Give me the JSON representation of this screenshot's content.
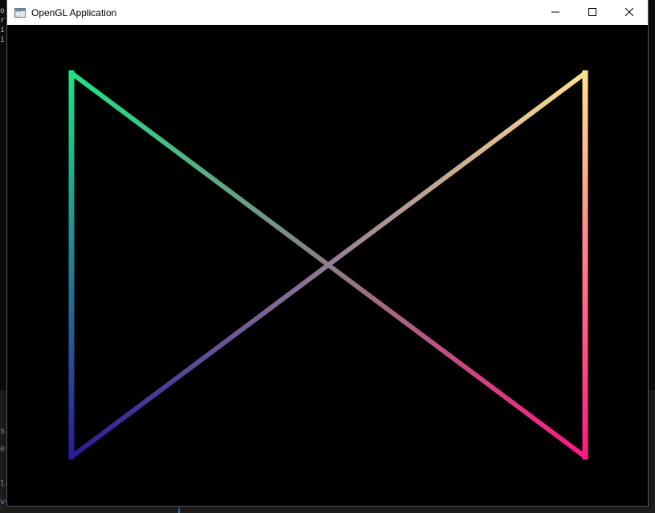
{
  "window": {
    "title": "OpenGL Application",
    "buttons": [
      "minimize",
      "maximize",
      "close"
    ],
    "icons": {
      "app": "window-app-icon",
      "minimize": "minimize-icon",
      "maximize": "maximize-icon",
      "close": "close-icon"
    }
  },
  "background": {
    "console_glyphs": "o\nr\ni\ni",
    "ide_lines": [
      "ss",
      "es",
      "le",
      "ve"
    ]
  },
  "scene": {
    "clear_color": "#000000",
    "shape": "bowtie line loop",
    "vertex_colors": {
      "top_left": "#1be486",
      "bottom_left": "#2a1a9c",
      "top_right": "#ffe08e",
      "bottom_right": "#ff1882"
    }
  }
}
